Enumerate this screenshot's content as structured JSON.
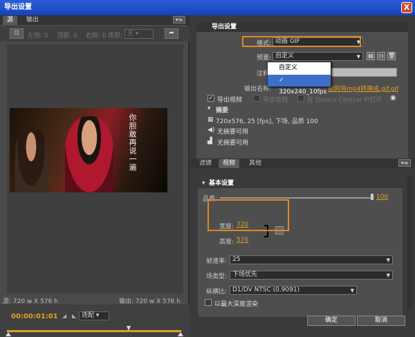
{
  "window": {
    "title": "导出设置",
    "close": "X"
  },
  "left": {
    "tabs": [
      "源",
      "输出"
    ],
    "options_icon": "▾≡",
    "crop_icon": "crop-icon",
    "crop_fields": [
      "左侧: 0",
      "顶部: 0",
      "右侧: 0",
      "底部: 0"
    ],
    "ratio": "无",
    "share_icon": "share-icon",
    "subtitle": "你胆敢再说一遍",
    "source_info": "源: 720 w X 576 h",
    "output_info": "输出: 720 w X 576 h",
    "timecode": "00:00:01:01",
    "fit": "适配"
  },
  "export": {
    "title": "导出设置",
    "format_label": "格式:",
    "format_value": "动画 GIF",
    "preset_label": "预置:",
    "preset_value": "自定义",
    "notes_label": "注释:",
    "output_label": "输出名称:",
    "output_value": "如何将mp4转换成.gif.gif",
    "export_video": "导出视频",
    "export_audio": "导出音频",
    "open_dc": "在 Device Central 中打开",
    "summary": "摘要",
    "summary_lines": [
      "720x576, 25 [fps], 下场, 品质 100",
      "无摘要可用",
      "无摘要可用"
    ],
    "preset_options": [
      "自定义",
      "320x240_10fps"
    ]
  },
  "tabs2": [
    "滤镜",
    "视频",
    "其他"
  ],
  "basic": {
    "title": "基本设置",
    "quality_label": "品质:",
    "quality_value": "100",
    "width_label": "宽度:",
    "width_value": "720",
    "height_label": "高度:",
    "height_value": "576",
    "framerate_label": "帧速率:",
    "framerate_value": "25",
    "field_label": "场类型:",
    "field_value": "下场优先",
    "aspect_label": "纵横比:",
    "aspect_value": "D1/DV NTSC (0.9091)",
    "max_depth": "以最大深度渲染"
  },
  "buttons": {
    "ok": "确定",
    "cancel": "取消"
  },
  "colors": {
    "accent": "#e0a020",
    "title_blue": "#2a5fd8",
    "highlight": "#3d6fc9"
  }
}
